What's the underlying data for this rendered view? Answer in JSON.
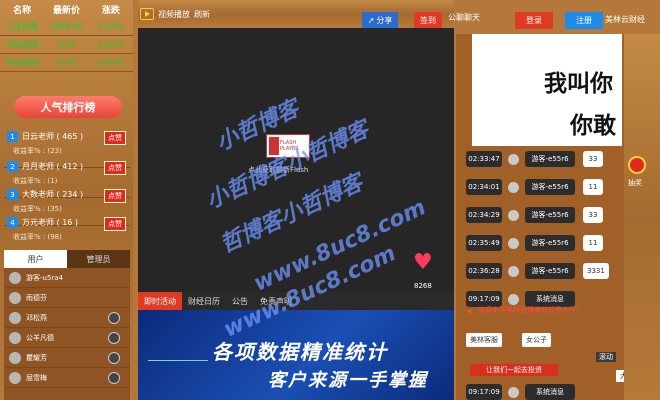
{
  "quotes": {
    "headers": [
      "名称",
      "最新价",
      "涨跌"
    ],
    "rows": [
      {
        "name": "上证指数",
        "price": "2889.95",
        "change": "0.00%"
      },
      {
        "name": "深证成指",
        "price": "0.00",
        "change": "0.00%"
      },
      {
        "name": "创业板指",
        "price": "0.00",
        "change": "0.00%"
      }
    ]
  },
  "ranking": {
    "title": "人气排行榜",
    "subscribe_label": "点赞",
    "teachers": [
      {
        "num": "1",
        "name": "日云老师 ( 465 )",
        "rate": "收益率% : (23)"
      },
      {
        "num": "2",
        "name": "月月老师 ( 412 )",
        "rate": "收益率% : (1)"
      },
      {
        "num": "3",
        "name": "大数老师 ( 234 )",
        "rate": "收益率% : (35)"
      },
      {
        "num": "4",
        "name": "万元老师 ( 16 )",
        "rate": "收益率% : (98)"
      }
    ]
  },
  "users": {
    "tabs": [
      "用户",
      "管理员"
    ],
    "list": [
      "游客-u5ra4",
      "雨德芬",
      "邓松燕",
      "公羊凡德",
      "瞿耀芳",
      "屈雪梅"
    ]
  },
  "player": {
    "tab_label": "视频播放",
    "refresh_label": "刷新",
    "flash_logo": "FLASH PLAYER",
    "flash_text": "点此获取最新Flash",
    "likes": "8268"
  },
  "center_tabs": [
    "即时活动",
    "财经日历",
    "公告",
    "免责声明"
  ],
  "banner": {
    "line1": "各项数据精准统计",
    "line2": "客户来源一手掌握"
  },
  "header": {
    "share": "分享",
    "sign": "签到",
    "chat_title": "公聊聊天",
    "login": "登录",
    "register": "注册",
    "brand": "美林云财经"
  },
  "chat": {
    "meme_line1": "我叫你",
    "meme_line2": "你敢",
    "messages": [
      {
        "time": "02:33:47",
        "who": "游客-e55r6",
        "text": "33"
      },
      {
        "time": "02:34:01",
        "who": "游客-e55r6",
        "text": "11"
      },
      {
        "time": "02:34:29",
        "who": "游客-e55r6",
        "text": "33"
      },
      {
        "time": "02:35:49",
        "who": "游客-e55r6",
        "text": "11"
      },
      {
        "time": "02:36:28",
        "who": "游客-e55r6",
        "text": "3331"
      },
      {
        "time": "09:17:09",
        "who": "系统消息",
        "text": ""
      }
    ],
    "welcome": "欢迎来到美林直播美林投资大厅!",
    "people": [
      "美林客服",
      "女公子"
    ],
    "scroll_label": "滚动",
    "warn_text": "让我们一起去投资",
    "tail_time": "09:17:09",
    "tail_who": "系统消息",
    "tail_select": "大话"
  },
  "gift": {
    "label": "抽奖"
  },
  "watermarks": [
    "小哲博客",
    "小哲博客小哲博客",
    "哲博客小哲博客",
    "www.8uc8.com",
    "www.8uc8.com"
  ]
}
